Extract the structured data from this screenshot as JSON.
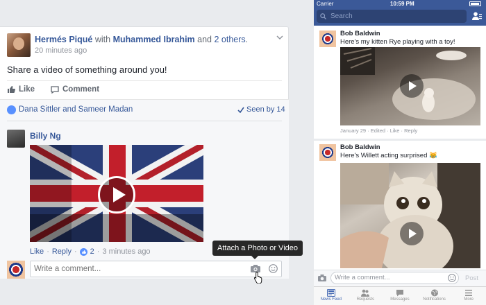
{
  "desktop": {
    "post": {
      "author": "Hermés Piqué",
      "with_text": "with",
      "tagged": "Muhammed Ibrahim",
      "and_text": "and",
      "others": "2 others",
      "period": ".",
      "time": "20 minutes ago",
      "message": "Share a video of something around you!",
      "like_label": "Like",
      "comment_label": "Comment",
      "likers": "Dana Sittler and Sameer Madan",
      "seen": "Seen by 14"
    },
    "comment": {
      "author": "Billy Ng",
      "like_label": "Like",
      "dot": "·",
      "reply_label": "Reply",
      "likes_count": "2",
      "time": "3 minutes ago"
    },
    "tooltip": "Attach a Photo or Video",
    "comment_placeholder": "Write a comment..."
  },
  "phone": {
    "status": {
      "carrier": "Carrier",
      "time": "10:59 PM"
    },
    "search_placeholder": "Search",
    "posts": [
      {
        "author": "Bob Baldwin",
        "text": "Here's my kitten Rye playing with a toy!",
        "meta": "January 29 · Edited · Like · Reply"
      },
      {
        "author": "Bob Baldwin",
        "text": "Here's Willett acting surprised 😹"
      }
    ],
    "comment_placeholder": "Write a comment...",
    "post_label": "Post",
    "tabs": [
      {
        "label": "News Feed",
        "icon": "news-feed-icon",
        "active": true
      },
      {
        "label": "Requests",
        "icon": "friend-requests-icon",
        "active": false
      },
      {
        "label": "Messages",
        "icon": "messages-icon",
        "active": false
      },
      {
        "label": "Notifications",
        "icon": "globe-icon",
        "active": false
      },
      {
        "label": "More",
        "icon": "menu-icon",
        "active": false
      }
    ]
  },
  "colors": {
    "brand": "#3b5998",
    "link": "#365899",
    "like": "#5890ff"
  }
}
